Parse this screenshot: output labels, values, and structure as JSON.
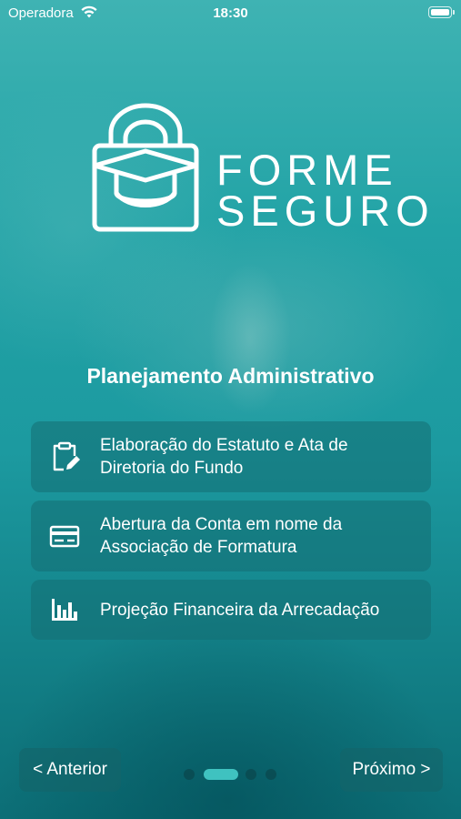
{
  "status_bar": {
    "carrier": "Operadora",
    "time": "18:30"
  },
  "logo": {
    "line1": "FORME",
    "line2": "SEGURO"
  },
  "section_title": "Planejamento Administrativo",
  "items": [
    {
      "icon": "clipboard-edit-icon",
      "line1": "Elaboração do Estatuto e Ata de",
      "line2": "Diretoria do Fundo"
    },
    {
      "icon": "bank-card-icon",
      "line1": "Abertura da Conta em nome da",
      "line2": "Associação de Formatura"
    },
    {
      "icon": "bar-chart-icon",
      "line1": "Projeção Financeira da Arrecadação"
    }
  ],
  "nav": {
    "prev_label": "< Anterior",
    "next_label": "Próximo >"
  },
  "pagination": {
    "total": 4,
    "active": 1
  }
}
